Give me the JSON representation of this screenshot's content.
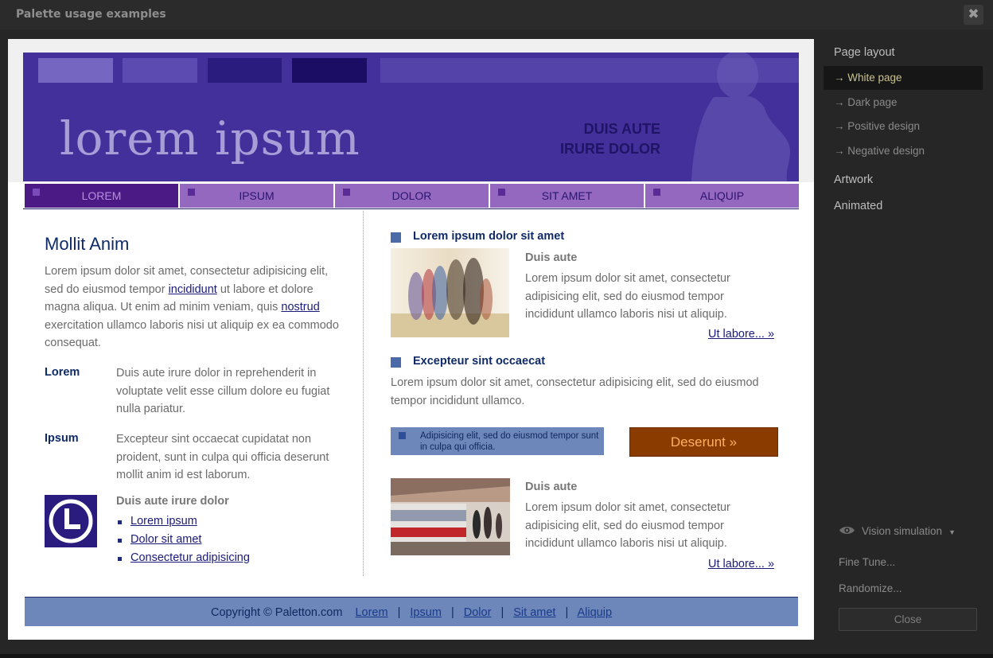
{
  "window": {
    "title": "Palette usage examples",
    "close_glyph": "✖"
  },
  "header": {
    "logo_text": "lorem ipsum",
    "tagline_line1": "DUIS AUTE",
    "tagline_line2": "IRURE DOLOR"
  },
  "nav": {
    "items": [
      "LOREM",
      "IPSUM",
      "DOLOR",
      "SIT AMET",
      "ALIQUIP"
    ],
    "active_index": 0
  },
  "left": {
    "heading": "Mollit Anim",
    "intro": {
      "part1": "Lorem ipsum dolor sit amet, consectetur adipisicing elit, sed do eiusmod tempor ",
      "link1": "incididunt",
      "part2": " ut labore et dolore magna aliqua. Ut enim ad minim veniam, quis ",
      "link2": "nostrud",
      "part3": " exercitation ullamco laboris nisi ut aliquip ex ea commodo consequat."
    },
    "definitions": [
      {
        "term": "Lorem",
        "text": "Duis aute irure dolor in reprehenderit in voluptate velit esse cillum dolore eu fugiat nulla pariatur."
      },
      {
        "term": "Ipsum",
        "text": "Excepteur sint occaecat cupidatat non proident, sunt in culpa qui officia deserunt mollit anim id est laborum."
      }
    ],
    "links_title": "Duis aute irure dolor",
    "links": [
      "Lorem ipsum",
      "Dolor sit amet",
      "Consectetur adipisicing"
    ]
  },
  "right": {
    "section1": {
      "title": "Lorem ipsum dolor sit amet",
      "subtitle": "Duis aute",
      "text": "Lorem ipsum dolor sit amet, consectetur adipisicing elit, sed do eiusmod tempor incididunt ullamco laboris nisi ut aliquip.",
      "more": "Ut labore... »"
    },
    "section2": {
      "title": "Excepteur sint occaecat",
      "text": "Lorem ipsum dolor sit amet, consectetur adipisicing elit, sed do eiusmod tempor incididunt ullamco."
    },
    "callout": "Adipisicing elit, sed do eiusmod tempor sunt in culpa qui officia.",
    "cta": "Deserunt »",
    "section3": {
      "subtitle": "Duis aute",
      "text": "Lorem ipsum dolor sit amet, consectetur adipisicing elit, sed do eiusmod tempor incididunt ullamco laboris nisi ut aliquip.",
      "more": "Ut labore... »"
    }
  },
  "footer": {
    "copyright": "Copyright © Paletton.com",
    "links": [
      "Lorem",
      "Ipsum",
      "Dolor",
      "Sit amet",
      "Aliquip"
    ],
    "separator": "|"
  },
  "panel": {
    "page_layout": "Page layout",
    "layout_items": [
      "→  White page",
      "→  Dark page",
      "→  Positive design",
      "→  Negative design"
    ],
    "selected_index": 0,
    "artwork": "Artwork",
    "animated": "Animated",
    "vision": "Vision simulation",
    "vision_caret": "▼",
    "fine_tune": "Fine Tune...",
    "randomize": "Randomize...",
    "close": "Close"
  },
  "icons": {
    "window_close": "close-icon",
    "vision": "eye-icon",
    "logo": "clock-logo-icon"
  },
  "colors": {
    "banner": "#43309a",
    "nav_item": "#9568bf",
    "nav_active": "#4b1a84",
    "accent_blue": "#6d87ba",
    "cta": "#8a3b00",
    "cta_text": "#ffb062"
  }
}
